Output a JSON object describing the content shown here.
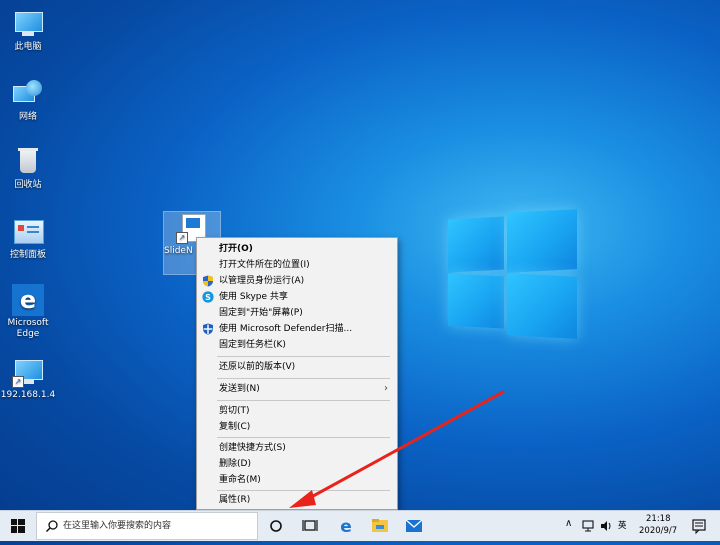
{
  "desktop": {
    "icons": [
      {
        "label": "此电脑"
      },
      {
        "label": "网络"
      },
      {
        "label": "回收站"
      },
      {
        "label": "控制面板"
      },
      {
        "label": "Microsoft Edge"
      },
      {
        "label": "192.168.1.4"
      },
      {
        "label": "SlideN Dow"
      }
    ]
  },
  "context_menu": {
    "items": [
      {
        "label": "打开(O)",
        "icon": ""
      },
      {
        "label": "打开文件所在的位置(I)",
        "icon": ""
      },
      {
        "label": "以管理员身份运行(A)",
        "icon": "shield-icon"
      },
      {
        "label": "使用 Skype 共享",
        "icon": "skype-icon"
      },
      {
        "label": "固定到\"开始\"屏幕(P)",
        "icon": ""
      },
      {
        "label": "使用 Microsoft Defender扫描...",
        "icon": "defender-icon"
      },
      {
        "label": "固定到任务栏(K)",
        "icon": ""
      },
      {
        "label": "还原以前的版本(V)",
        "icon": ""
      },
      {
        "label": "发送到(N)",
        "icon": "",
        "submenu": true
      },
      {
        "label": "剪切(T)",
        "icon": ""
      },
      {
        "label": "复制(C)",
        "icon": ""
      },
      {
        "label": "创建快捷方式(S)",
        "icon": ""
      },
      {
        "label": "删除(D)",
        "icon": ""
      },
      {
        "label": "重命名(M)",
        "icon": ""
      },
      {
        "label": "属性(R)",
        "icon": ""
      }
    ]
  },
  "taskbar": {
    "search_placeholder": "在这里输入你要搜索的内容",
    "pinned": [
      "cortana-icon",
      "task-view-icon",
      "edge-icon",
      "file-explorer-icon",
      "mail-icon"
    ],
    "tray": {
      "ime": "英",
      "time": "21:18",
      "date": "2020/9/7"
    }
  },
  "colors": {
    "annotation_arrow": "#e8231c",
    "menu_bg": "#f2f2f2",
    "taskbar_bg": "#e6ecf3"
  }
}
